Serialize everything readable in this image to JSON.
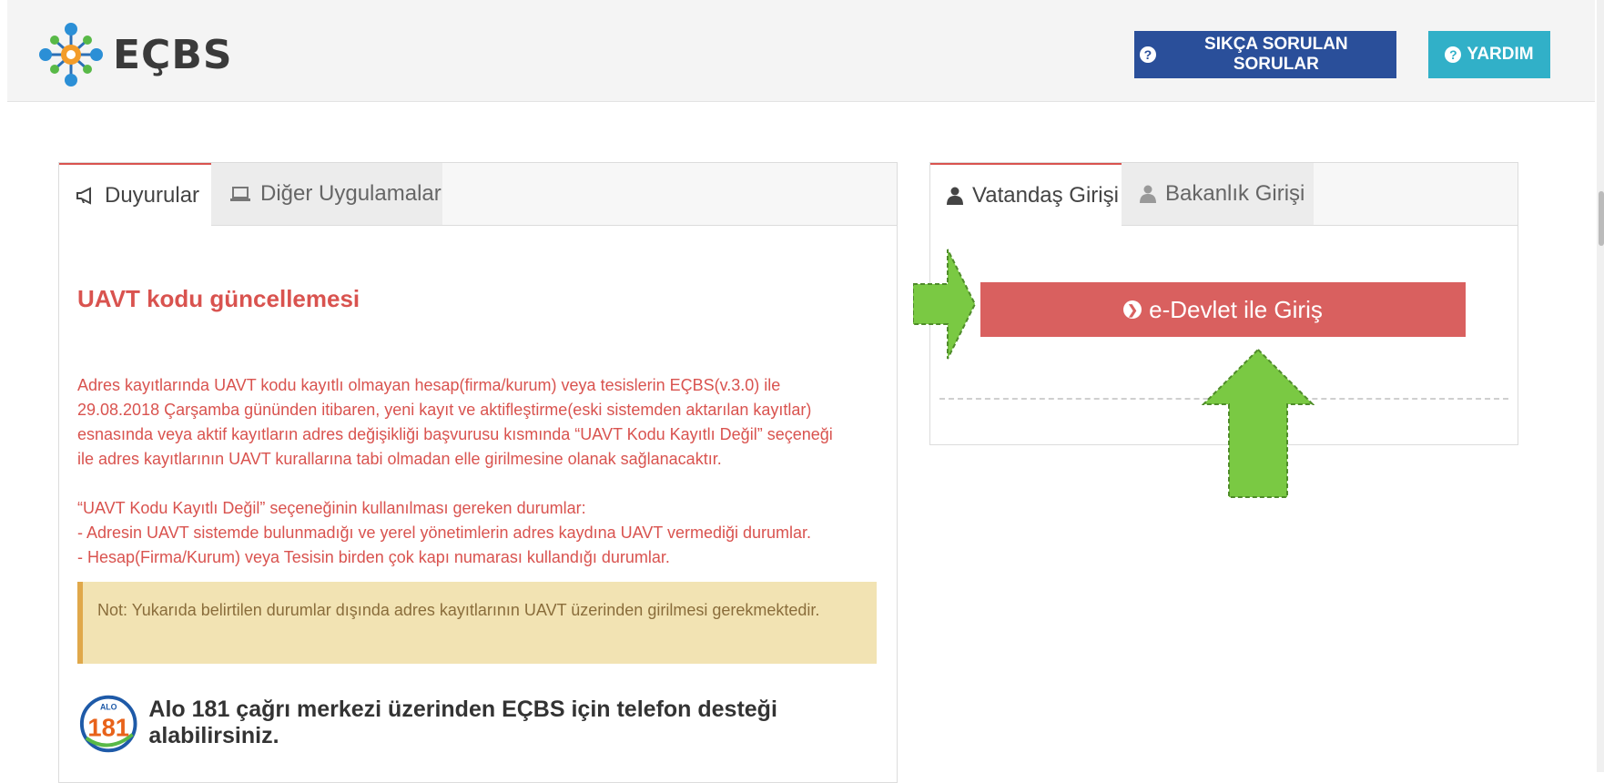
{
  "header": {
    "logo_text": "EÇBS",
    "faq_button": "SIKÇA SORULAN SORULAR",
    "help_button": "YARDIM",
    "colors": {
      "faq": "#2a4f9a",
      "help": "#31b0c8"
    }
  },
  "left_panel": {
    "tabs": [
      {
        "label": "Duyurular",
        "icon": "megaphone-icon",
        "active": true
      },
      {
        "label": "Diğer Uygulamalar",
        "icon": "laptop-icon",
        "active": false
      }
    ],
    "announcement": {
      "title": "UAVT kodu güncellemesi",
      "paragraph1": [
        "Adres kayıtlarında UAVT kodu kayıtlı olmayan hesap(firma/kurum) veya tesislerin EÇBS(v.3.0) ile",
        "29.08.2018 Çarşamba gününden itibaren, yeni kayıt ve aktifleştirme(eski sistemden aktarılan kayıtlar)",
        "esnasında veya aktif kayıtların adres değişikliği başvurusu kısmında “UAVT Kodu Kayıtlı Değil” seçeneği",
        "ile adres kayıtlarının UAVT kurallarına tabi olmadan elle girilmesine olanak sağlanacaktır."
      ],
      "paragraph2": [
        "“UAVT Kodu Kayıtlı Değil” seçeneğinin kullanılması gereken durumlar:",
        "- Adresin UAVT sistemde bulunmadığı ve yerel yönetimlerin adres kaydına UAVT vermediği durumlar.",
        "- Hesap(Firma/Kurum) veya Tesisin birden çok kapı numarası kullandığı durumlar."
      ],
      "note": "Not: Yukarıda belirtilen durumlar dışında adres kayıtlarının UAVT üzerinden girilmesi gerekmektedir.",
      "color": "#d9534f"
    },
    "alo": {
      "badge_top": "ALO",
      "badge_number": "181",
      "text": "Alo 181 çağrı merkezi üzerinden EÇBS için telefon desteği alabilirsiniz."
    }
  },
  "right_panel": {
    "tabs": [
      {
        "label": "Vatandaş Girişi",
        "icon": "user-icon",
        "active": true
      },
      {
        "label": "Bakanlık Girişi",
        "icon": "user-icon",
        "active": false
      }
    ],
    "login_button": "e-Devlet ile Giriş",
    "login_color": "#d9605f"
  },
  "annotations": {
    "arrow_color": "#7ac943"
  }
}
